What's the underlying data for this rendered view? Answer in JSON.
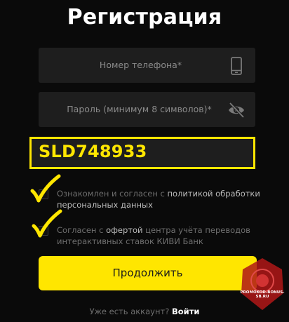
{
  "title": "Регистрация",
  "phone_field": {
    "placeholder": "Номер телефона*",
    "icon": "smartphone-icon"
  },
  "password_field": {
    "placeholder": "Пароль (минимум 8 символов)*",
    "icon": "eye-off-icon"
  },
  "promo_code": "SLD748933",
  "consent_1": {
    "text_before": "Ознакомлен и согласен с ",
    "link": "политикой обработки персональных данных",
    "checked": false
  },
  "consent_2": {
    "text_before": "Согласен с ",
    "link": "офертой",
    "text_after": " центра учёта переводов интерактивных ставок КИВИ Банк",
    "checked": false
  },
  "continue_label": "Продолжить",
  "footer": {
    "question": "Уже есть аккаунт? ",
    "login_link": "Войти"
  },
  "watermark": "PROMOKOD-BONUS-SB.RU",
  "colors": {
    "accent": "#ffe600",
    "background": "#0a0a0a",
    "field": "#1e1e1e",
    "watermark": "#b01818"
  }
}
